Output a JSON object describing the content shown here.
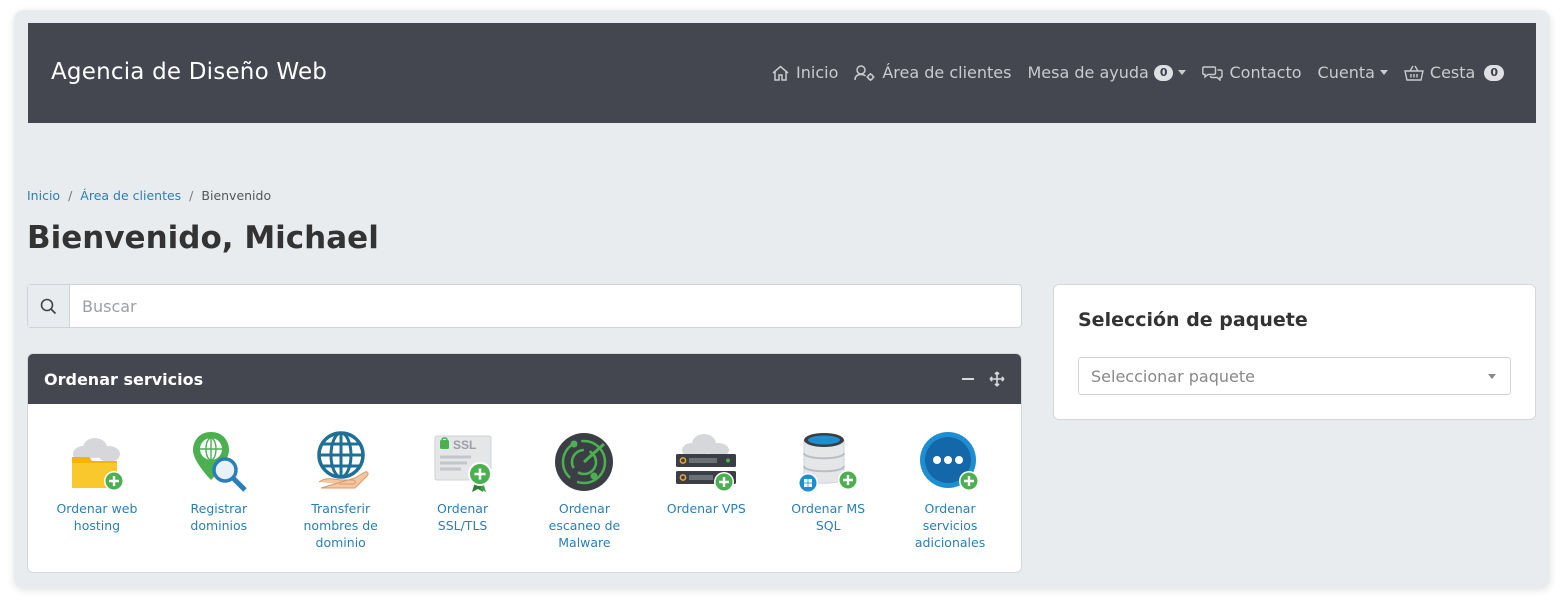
{
  "header": {
    "brand": "Agencia de Diseño Web",
    "nav": {
      "home": "Inicio",
      "client_area": "Área de clientes",
      "helpdesk": "Mesa de ayuda",
      "helpdesk_count": "0",
      "contact": "Contacto",
      "account": "Cuenta",
      "cart": "Cesta",
      "cart_count": "0"
    }
  },
  "breadcrumb": {
    "home": "Inicio",
    "client_area": "Área de clientes",
    "current": "Bienvenido"
  },
  "page_title": "Bienvenido, Michael",
  "search": {
    "placeholder": "Buscar"
  },
  "order_services": {
    "title": "Ordenar servicios",
    "items": [
      {
        "label": "Ordenar web hosting",
        "icon": "hosting-folder-icon"
      },
      {
        "label": "Registrar dominios",
        "icon": "domain-register-icon"
      },
      {
        "label": "Transferir nombres de dominio",
        "icon": "domain-transfer-icon"
      },
      {
        "label": "Ordenar SSL/TLS",
        "icon": "ssl-certificate-icon"
      },
      {
        "label": "Ordenar escaneo de Malware",
        "icon": "malware-scan-icon"
      },
      {
        "label": "Ordenar VPS",
        "icon": "vps-server-icon"
      },
      {
        "label": "Ordenar MS SQL",
        "icon": "mssql-database-icon"
      },
      {
        "label": "Ordenar servicios adicionales",
        "icon": "more-services-icon"
      }
    ]
  },
  "package_selection": {
    "title": "Selección de paquete",
    "placeholder": "Seleccionar paquete"
  },
  "colors": {
    "navbar": "#444650",
    "link": "#2a7fb8",
    "background": "#e9ecef",
    "plus_badge": "#4caf50"
  }
}
